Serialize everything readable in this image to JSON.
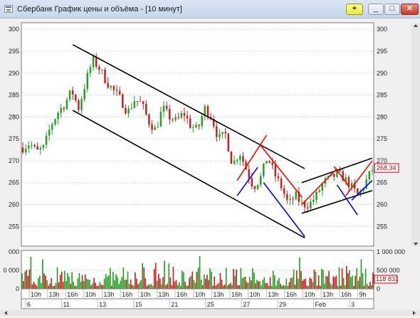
{
  "window": {
    "title": "Сбербанк График цены и объёма - [10 минут]",
    "link_icon": "link-icon",
    "minimize_glyph": "_",
    "maximize_glyph": "□",
    "close_glyph": "✕"
  },
  "colors": {
    "up_candle": "#22a022",
    "down_candle": "#c81e1e",
    "trend_channel": "#000000",
    "red_trendline": "#ff0000",
    "blue_trendline": "#0000ff",
    "volume_up": "#22a022",
    "volume_down": "#c81e1e",
    "price_label": "#d00000"
  },
  "chart_data": [
    {
      "type": "candlestick",
      "title": "",
      "y_ticks": [
        255,
        260,
        265,
        270,
        275,
        280,
        285,
        290,
        295,
        300
      ],
      "ylim": [
        250.5,
        301.5
      ],
      "grid": true,
      "last_price_label": "268,34",
      "x_time_labels": [
        "10h",
        "13h",
        "16h",
        "10h",
        "13h",
        "16h",
        "10h",
        "13h",
        "16h",
        "10h",
        "13h",
        "16h",
        "10h",
        "13h",
        "16h",
        "10h",
        "13h",
        "16h",
        "9h"
      ],
      "x_date_labels": [
        "6",
        "11",
        "13",
        "15",
        "21",
        "25",
        "27",
        "29",
        "Feb",
        "3"
      ],
      "price_anchors": [
        [
          0,
          273
        ],
        [
          2,
          274
        ],
        [
          4,
          272
        ],
        [
          6,
          273
        ],
        [
          8,
          278
        ],
        [
          10,
          281
        ],
        [
          12,
          283
        ],
        [
          14,
          286
        ],
        [
          16,
          282
        ],
        [
          18,
          288
        ],
        [
          20,
          293
        ],
        [
          22,
          291
        ],
        [
          24,
          288
        ],
        [
          26,
          286
        ],
        [
          28,
          284
        ],
        [
          30,
          281
        ],
        [
          32,
          284
        ],
        [
          34,
          283
        ],
        [
          36,
          279
        ],
        [
          38,
          277
        ],
        [
          40,
          282
        ],
        [
          42,
          280
        ],
        [
          44,
          279
        ],
        [
          46,
          281
        ],
        [
          48,
          278
        ],
        [
          50,
          277
        ],
        [
          52,
          282
        ],
        [
          54,
          280
        ],
        [
          56,
          275
        ],
        [
          58,
          276
        ],
        [
          60,
          269
        ],
        [
          62,
          272
        ],
        [
          64,
          268
        ],
        [
          66,
          264
        ],
        [
          68,
          266
        ],
        [
          70,
          271
        ],
        [
          72,
          267
        ],
        [
          74,
          264
        ],
        [
          76,
          260
        ],
        [
          78,
          262
        ],
        [
          80,
          260
        ],
        [
          82,
          260
        ],
        [
          84,
          262
        ],
        [
          86,
          265
        ],
        [
          88,
          266
        ],
        [
          90,
          267
        ],
        [
          92,
          266
        ],
        [
          94,
          264
        ],
        [
          96,
          262
        ],
        [
          98,
          265
        ],
        [
          100,
          268
        ]
      ],
      "trendlines": [
        {
          "color": "black",
          "from": [
            17,
            296.5
          ],
          "to": [
            96,
            268.2
          ]
        },
        {
          "color": "black",
          "from": [
            17,
            281.5
          ],
          "to": [
            96,
            252.4
          ]
        },
        {
          "color": "black",
          "from": [
            95,
            265.0
          ],
          "to": [
            119,
            270.6
          ]
        },
        {
          "color": "black",
          "from": [
            95,
            258.0
          ],
          "to": [
            119,
            263.2
          ]
        },
        {
          "color": "red",
          "from": [
            73,
            265.5
          ],
          "to": [
            83,
            275.8
          ]
        },
        {
          "color": "blue",
          "from": [
            73,
            262.0
          ],
          "to": [
            80,
            268.5
          ]
        },
        {
          "color": "red",
          "from": [
            81,
            273.5
          ],
          "to": [
            95,
            261.7
          ]
        },
        {
          "color": "blue",
          "from": [
            82,
            265.0
          ],
          "to": [
            96,
            252.7
          ]
        },
        {
          "color": "red",
          "from": [
            95,
            260.0
          ],
          "to": [
            107,
            268.2
          ]
        },
        {
          "color": "red",
          "from": [
            106,
            268.7
          ],
          "to": [
            111,
            264.2
          ]
        },
        {
          "color": "blue",
          "from": [
            107,
            264.5
          ],
          "to": [
            114,
            257.6
          ]
        },
        {
          "color": "red",
          "from": [
            110,
            262.0
          ],
          "to": [
            119,
            270.0
          ]
        },
        {
          "color": "blue",
          "from": [
            112,
            261.0
          ],
          "to": [
            119,
            265.5
          ]
        }
      ]
    },
    {
      "type": "bar",
      "title": "",
      "y_ticks_right": [
        "1 000 000",
        "500 000",
        "0"
      ],
      "y_ticks_left": [
        "000",
        "0 000",
        "0"
      ],
      "ylim": [
        0,
        1000000
      ],
      "last_volume_label": "118 831"
    }
  ]
}
